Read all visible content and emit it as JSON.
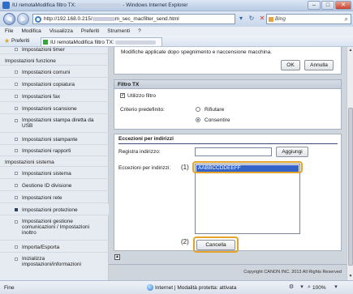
{
  "window": {
    "title_prefix": "IU remotaModifica filtro TX:",
    "title_suffix": "- Windows Internet Explorer",
    "btn_min": "–",
    "btn_max": "□",
    "btn_close": "✕"
  },
  "address": {
    "url_prefix": "http://192.168.0.215/",
    "url_suffix": "m_sec_macfilter_send.html",
    "search_placeholder": "Bing"
  },
  "menubar": [
    "File",
    "Modifica",
    "Visualizza",
    "Preferiti",
    "Strumenti",
    "?"
  ],
  "favbar": {
    "favorites_label": "Preferiti",
    "tab_title": "IU remotaModifica filtro TX:"
  },
  "sidebar": {
    "items": [
      {
        "label": "Impostazioni timer",
        "type": "item"
      },
      {
        "label": "Impostazioni funzione",
        "type": "head"
      },
      {
        "label": "Impostazioni comuni",
        "type": "item"
      },
      {
        "label": "Impostazioni copiatura",
        "type": "item"
      },
      {
        "label": "Impostazioni fax",
        "type": "item"
      },
      {
        "label": "Impostazioni scansione",
        "type": "item"
      },
      {
        "label": "Impostazioni stampa diretta da",
        "label2": "USB",
        "type": "item"
      },
      {
        "label": "Impostazioni stampante",
        "type": "item"
      },
      {
        "label": "Impostazioni rapporti",
        "type": "item"
      },
      {
        "label": "Impostazioni sistema",
        "type": "head"
      },
      {
        "label": "Impostazioni sistema",
        "type": "item"
      },
      {
        "label": "Gestione ID divisione",
        "type": "item"
      },
      {
        "label": "Impostazioni rete",
        "type": "item"
      },
      {
        "label": "Impostazioni protezione",
        "type": "item",
        "active": true
      },
      {
        "label": "Impostazioni gestione",
        "label2": "comunicazioni / Impostazioni",
        "label3": "inoltro",
        "type": "item"
      },
      {
        "label": "Importa/Esporta",
        "type": "item"
      },
      {
        "label": "Inizializza",
        "label2": "impostazioni/informazioni",
        "type": "item"
      }
    ]
  },
  "main": {
    "message": "Modifiche applicate dopo spegnimento e naccensione macchina.",
    "ok_label": "OK",
    "cancel_label": "Annulla",
    "filter_section": "Filtro TX",
    "use_filter_label": "Utilizzo filtro",
    "use_filter_checked": true,
    "default_policy_label": "Criterio predefinito:",
    "radio_reject": "Rifiutare",
    "radio_accept": "Consentire",
    "selected_policy": "Consentire",
    "exceptions_section": "Eccezioni per indirizzi",
    "register_label": "Registra indirizzo:",
    "register_value": "",
    "add_label": "Aggiungi",
    "exceptions_label": "Eccezioni per indirizzi:",
    "exceptions_list": [
      "AABBCCDDEEFF"
    ],
    "delete_label": "Cancella",
    "callout1": "(1)",
    "callout2": "(2)",
    "copyright": "Copyright CANON INC. 2013 All Rights Reserved"
  },
  "status": {
    "done": "Fine",
    "zone": "Internet | Modalità protetta: attivata",
    "zoom": "100%"
  }
}
